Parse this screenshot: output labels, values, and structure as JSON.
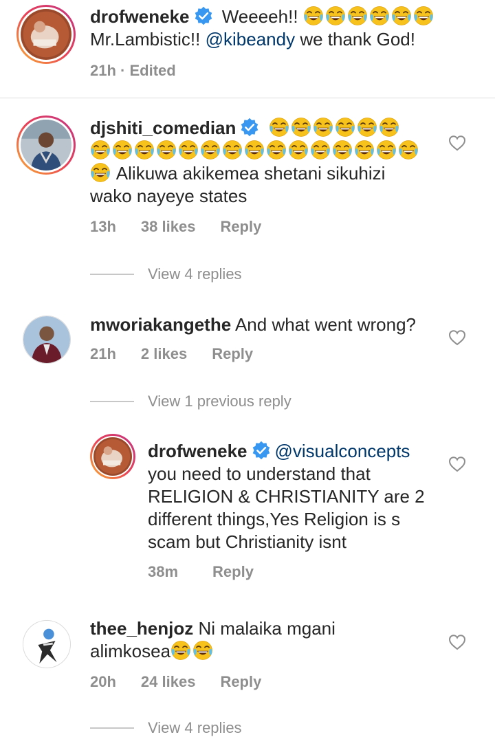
{
  "comments": [
    {
      "username": "drofweneke",
      "text_line1": "Weeeeh!!",
      "line2_prefix": "Mr.Lambistic!!",
      "line2_mention": "@kibeandy",
      "line2_suffix": "we thank God!",
      "time": "21h",
      "edited": "Edited"
    },
    {
      "username": "djshiti_comedian",
      "text": "Alikuwa akikemea shetani sikuhizi",
      "text_line2": "wako nayeye states",
      "time": "13h",
      "likes": "38 likes",
      "reply": "Reply",
      "view_replies": "View 4 replies"
    },
    {
      "username": "mworiakangethe",
      "text": "And what went wrong?",
      "time": "21h",
      "likes": "2 likes",
      "reply": "Reply",
      "view_replies": "View 1 previous reply"
    },
    {
      "username": "drofweneke",
      "mention": "@visualconcepts",
      "line2": "you need to understand that",
      "line3": "RELIGION & CHRISTIANITY are 2",
      "line4": "different things,Yes Religion is s",
      "line5": "scam but Christianity isnt",
      "time": "38m",
      "reply": "Reply"
    },
    {
      "username": "thee_henjoz",
      "text": "Ni malaika mgani",
      "text_line2": "alimkosea",
      "time": "20h",
      "likes": "24 likes",
      "reply": "Reply",
      "view_replies": "View 4 replies"
    }
  ],
  "colors": {
    "verified": "#3897f0",
    "mention": "#00376b",
    "meta": "#8e8e8e",
    "story_ring": "#e94057"
  },
  "icons": [
    "verified-badge-icon",
    "laughing-emoji-icon",
    "heart-icon"
  ]
}
